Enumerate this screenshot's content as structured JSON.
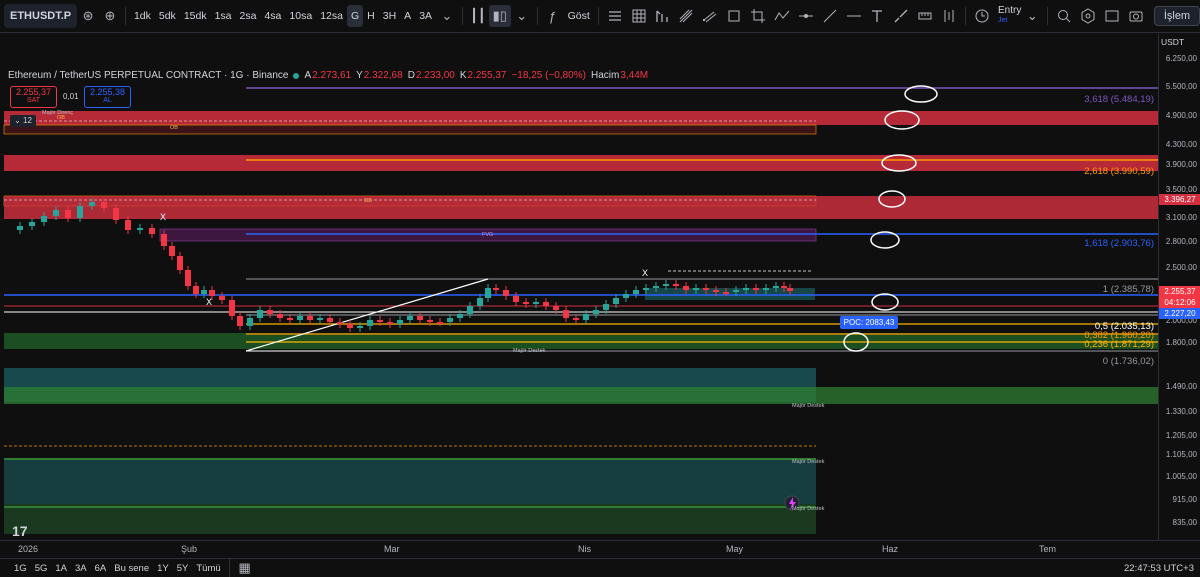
{
  "toolbar": {
    "symbol": "ETHUSDT.P",
    "timeframes": [
      "1dk",
      "5dk",
      "15dk",
      "1sa",
      "2sa",
      "4sa",
      "10sa",
      "12sa",
      "G",
      "H",
      "3H",
      "A",
      "3A"
    ],
    "active_timeframe": "G",
    "indicators_label": "Göst",
    "entry_label": "Entry",
    "entry_sub": "Jet",
    "trade_label": "İşlem"
  },
  "legend": {
    "title": "Ethereum / TetherUS PERPETUAL CONTRACT · 1G · Binance",
    "open_k": "A",
    "open_v": "2.273,61",
    "high_k": "Y",
    "high_v": "2.322,68",
    "low_k": "D",
    "low_v": "2.233,00",
    "close_k": "K",
    "close_v": "2.255,37",
    "change": "−18,25 (−0,80%)",
    "volume_k": "Hacim",
    "volume_v": "3,44M"
  },
  "trade": {
    "sell_price": "2.255,37",
    "sell_label": "SAT",
    "spread": "0,01",
    "buy_price": "2.255,38",
    "buy_label": "AL",
    "collapse_count": "12"
  },
  "price_axis": {
    "currency": "USDT",
    "labels": [
      "6.250,00",
      "5.500,00",
      "4.900,00",
      "4.300,00",
      "3.900,00",
      "3.500,00",
      "3.100,00",
      "2.800,00",
      "2.500,00",
      "2.000,00",
      "1.800,00",
      "1.490,00",
      "1.330,00",
      "1.205,00",
      "1.105,00",
      "1.005,00",
      "915,00",
      "835,00"
    ],
    "tag_3396": "3.396,27",
    "tag_current": "2.255,37",
    "tag_countdown": "04:12:06",
    "tag_2227": "2.227,20"
  },
  "fib": {
    "l3618": "3,618 (5.484,19)",
    "l2618": "2,618 (3.990,59)",
    "l1618": "1,618 (2.903,76)",
    "l1": "1 (2.385,78)",
    "l05": "0,5 (2.035,13)",
    "l0382": "0,382 (1.960,20)",
    "l0236": "0,236 (1.871,29)",
    "l0": "0 (1.736,02)"
  },
  "zones": {
    "majorResistance": "Majör Direnç",
    "ob": "OB",
    "fvg": "FVG",
    "majorSupport1": "Majör Destek",
    "majorSupport2": "Majör Destek",
    "majorSupport3": "Majör Destek",
    "majorSupport4": "Majör Destek",
    "x": "X",
    "poc": "POC: 2083,43"
  },
  "time_axis": {
    "labels": [
      "2026",
      "Şub",
      "Mar",
      "Nis",
      "May",
      "Haz",
      "Tem"
    ]
  },
  "bottom": {
    "ranges": [
      "1G",
      "5G",
      "1A",
      "3A",
      "6A",
      "Bu sene",
      "1Y",
      "5Y",
      "Tümü"
    ],
    "clock": "22:47:53 UTC+3"
  },
  "colors": {
    "up": "#26a69a",
    "down": "#f23645",
    "fib_3618": "#7e57c2",
    "fib_2618": "#ff9800",
    "fib_1618": "#2962ff",
    "zone_red": "#e03040",
    "zone_teal": "#1b5e63",
    "zone_green": "#2e7d32"
  }
}
